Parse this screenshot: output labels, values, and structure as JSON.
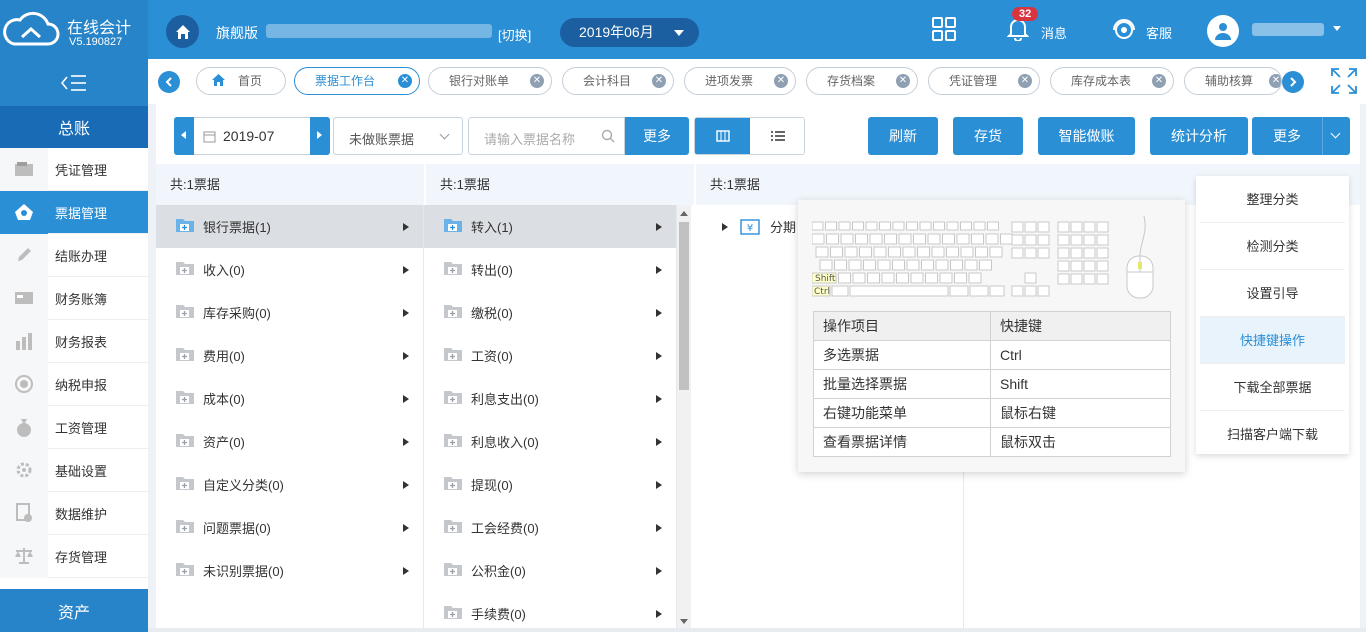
{
  "app": {
    "name": "在线会计",
    "version": "V5.190827"
  },
  "header": {
    "edition": "旗舰版",
    "switch_label": "[切换]",
    "period": "2019年06月",
    "msg_badge": "32",
    "msg_label": "消息",
    "service_label": "客服"
  },
  "sidebar": {
    "section_top": "总账",
    "items": [
      {
        "label": "凭证管理",
        "icon": "voucher-icon"
      },
      {
        "label": "票据管理",
        "icon": "bill-icon"
      },
      {
        "label": "结账办理",
        "icon": "pencil-icon"
      },
      {
        "label": "财务账簿",
        "icon": "ledger-icon"
      },
      {
        "label": "财务报表",
        "icon": "report-icon"
      },
      {
        "label": "纳税申报",
        "icon": "tax-icon"
      },
      {
        "label": "工资管理",
        "icon": "salary-icon"
      },
      {
        "label": "基础设置",
        "icon": "gear-icon"
      },
      {
        "label": "数据维护",
        "icon": "data-icon"
      },
      {
        "label": "存货管理",
        "icon": "scale-icon"
      }
    ],
    "section_bottom": "资产"
  },
  "tabs": [
    {
      "label": "首页"
    },
    {
      "label": "票据工作台"
    },
    {
      "label": "银行对账单"
    },
    {
      "label": "会计科目"
    },
    {
      "label": "进项发票"
    },
    {
      "label": "存货档案"
    },
    {
      "label": "凭证管理"
    },
    {
      "label": "库存成本表"
    },
    {
      "label": "辅助核算"
    }
  ],
  "toolbar": {
    "date": "2019-07",
    "filter": "未做账票据",
    "search_placeholder": "请输入票据名称",
    "more1": "更多",
    "refresh": "刷新",
    "stock": "存货",
    "smart": "智能做账",
    "stat": "统计分析",
    "more2": "更多"
  },
  "columns": {
    "count1": "共:1票据",
    "count2": "共:1票据",
    "count3": "共:1票据",
    "col1": [
      "银行票据(1)",
      "收入(0)",
      "库存采购(0)",
      "费用(0)",
      "成本(0)",
      "资产(0)",
      "自定义分类(0)",
      "问题票据(0)",
      "未识别票据(0)"
    ],
    "col2": [
      "转入(1)",
      "转出(0)",
      "缴税(0)",
      "工资(0)",
      "利息支出(0)",
      "利息收入(0)",
      "提现(0)",
      "工会经费(0)",
      "公积金(0)",
      "手续费(0)"
    ],
    "col3_item": "分期"
  },
  "shortcuts": {
    "key_shift": "Shift",
    "key_ctrl": "Ctrl",
    "head": [
      "操作项目",
      "快捷键"
    ],
    "rows": [
      [
        "多选票据",
        "Ctrl"
      ],
      [
        "批量选择票据",
        "Shift"
      ],
      [
        "右键功能菜单",
        "鼠标右键"
      ],
      [
        "查看票据详情",
        "鼠标双击"
      ]
    ]
  },
  "more_menu": [
    "整理分类",
    "检测分类",
    "设置引导",
    "快捷键操作",
    "下载全部票据",
    "扫描客户端下载"
  ]
}
